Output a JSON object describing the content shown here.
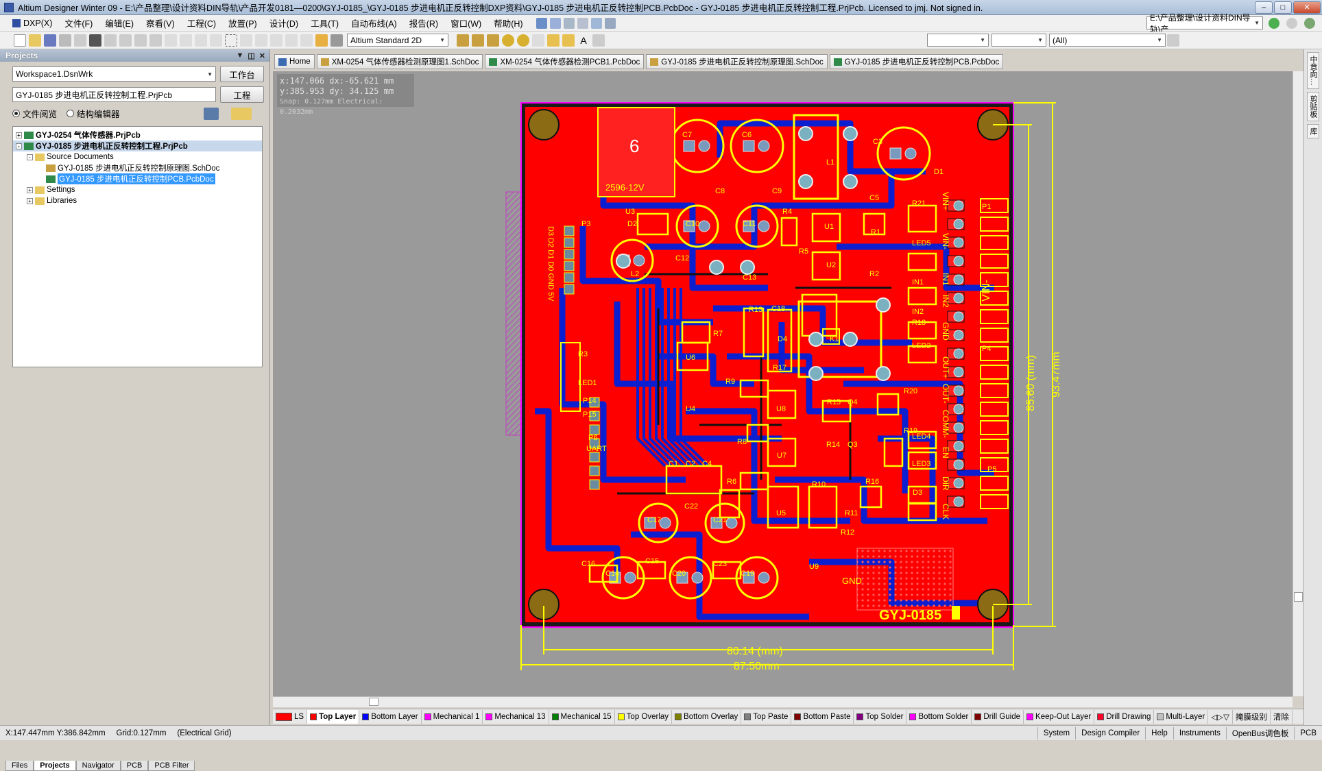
{
  "titlebar": {
    "title": "Altium Designer Winter 09 - E:\\产品整理\\设计资料DIN导轨\\产品开发0181—0200\\GYJ-0185_\\GYJ-0185 步进电机正反转控制DXP资料\\GYJ-0185 步进电机正反转控制PCB.PcbDoc - GYJ-0185 步进电机正反转控制工程.PrjPcb. Licensed to jmj. Not signed in."
  },
  "menu": {
    "dxp": "DXP(X)",
    "items": [
      "文件(F)",
      "编辑(E)",
      "察看(V)",
      "工程(C)",
      "放置(P)",
      "设计(D)",
      "工具(T)",
      "自动布线(A)",
      "报告(R)",
      "窗口(W)",
      "帮助(H)"
    ],
    "path_box": "E:\\产品整理\\设计资料DIN导轨\\产"
  },
  "toolbar": {
    "view_mode": "Altium Standard 2D",
    "filter_all": "(All)"
  },
  "projects_panel": {
    "title": "Projects",
    "workspace": "Workspace1.DsnWrk",
    "workspace_btn": "工作台",
    "project": "GYJ-0185 步进电机正反转控制工程.PrjPcb",
    "project_btn": "工程",
    "radio_files": "文件阅览",
    "radio_struct": "结构编辑器",
    "tree": [
      {
        "label": "GYJ-0254 气体传感器.PrjPcb",
        "indent": 0,
        "exp": "+",
        "bold": true
      },
      {
        "label": "GYJ-0185 步进电机正反转控制工程.PrjPcb",
        "indent": 0,
        "exp": "-",
        "bold": true,
        "hl": true
      },
      {
        "label": "Source Documents",
        "indent": 1,
        "exp": "-"
      },
      {
        "label": "GYJ-0185 步进电机正反转控制原理图.SchDoc",
        "indent": 2,
        "exp": ""
      },
      {
        "label": "GYJ-0185 步进电机正反转控制PCB.PcbDoc",
        "indent": 2,
        "exp": "",
        "sel": true
      },
      {
        "label": "Settings",
        "indent": 1,
        "exp": "+"
      },
      {
        "label": "Libraries",
        "indent": 1,
        "exp": "+"
      }
    ],
    "tabs": [
      "Files",
      "Projects",
      "Navigator",
      "PCB",
      "PCB Filter"
    ]
  },
  "doc_tabs": [
    {
      "label": "Home",
      "color": "#3a6ab0"
    },
    {
      "label": "XM-0254 气体传感器检测原理图1.SchDoc",
      "color": "#c8a040"
    },
    {
      "label": "XM-0254 气体传感器检测PCB1.PcbDoc",
      "color": "#2f8a4a"
    },
    {
      "label": "GYJ-0185 步进电机正反转控制原理图.SchDoc",
      "color": "#c8a040"
    },
    {
      "label": "GYJ-0185 步进电机正反转控制PCB.PcbDoc",
      "color": "#2f8a4a"
    }
  ],
  "hud": {
    "line1": "x:147.066   dx:-65.621 mm",
    "line2": "y:385.953   dy: 34.125  mm",
    "line3": "Snap: 0.127mm Electrical: 0.2032mm"
  },
  "pcb": {
    "board_label": "GYJ-0185",
    "relay_text": "2596-12V",
    "relay_num": "6",
    "dim_inner_w": "80.14 (mm)",
    "dim_outer_w": "87.50mm",
    "dim_inner_h": "85.60 (mm)",
    "dim_outer_h": "93.47mm",
    "gnd": "GND",
    "refs": [
      "C7",
      "C6",
      "C3",
      "L1",
      "D1",
      "C8",
      "C9",
      "C5",
      "R21",
      "P1",
      "U3",
      "D2",
      "C10",
      "C11",
      "R4",
      "U1",
      "R1",
      "LED5",
      "L2",
      "C12",
      "C13",
      "R5",
      "U2",
      "R2",
      "IN1",
      "IN2",
      "P3",
      "C18",
      "R18",
      "LED2",
      "R7",
      "R13",
      "D4",
      "K1",
      "P4",
      "U6",
      "R17",
      "R3",
      "R9",
      "R20",
      "LED1",
      "U4",
      "P14",
      "P15",
      "U8",
      "R15",
      "Q4",
      "P6",
      "UART",
      "R8",
      "R14",
      "Q3",
      "R19",
      "LED4",
      "LED3",
      "U7",
      "P5",
      "C1",
      "C2",
      "C4",
      "R6",
      "R10",
      "R16",
      "C22",
      "U5",
      "R11",
      "R12",
      "D3",
      "C17",
      "C21",
      "C16",
      "C15",
      "C23",
      "C14",
      "C20",
      "C19",
      "U9",
      "VIN+",
      "VIN-",
      "IN1",
      "IN2",
      "GND",
      "OUT+",
      "OUT-",
      "COM",
      "M-",
      "EN",
      "DIR",
      "CLK",
      "D3 D2 D1 D0 GND 5V",
      "P1.4",
      "P1.5",
      "GND",
      "VIN-",
      "VIN+"
    ]
  },
  "layers": [
    {
      "label": "LS",
      "color": "#ff0000"
    },
    {
      "label": "Top Layer",
      "color": "#ff0000",
      "on": true
    },
    {
      "label": "Bottom Layer",
      "color": "#0000ff"
    },
    {
      "label": "Mechanical 1",
      "color": "#ff00ff"
    },
    {
      "label": "Mechanical 13",
      "color": "#ff00ff"
    },
    {
      "label": "Mechanical 15",
      "color": "#008000"
    },
    {
      "label": "Top Overlay",
      "color": "#ffff00"
    },
    {
      "label": "Bottom Overlay",
      "color": "#808000"
    },
    {
      "label": "Top Paste",
      "color": "#808080"
    },
    {
      "label": "Bottom Paste",
      "color": "#800000"
    },
    {
      "label": "Top Solder",
      "color": "#800080"
    },
    {
      "label": "Bottom Solder",
      "color": "#ff00ff"
    },
    {
      "label": "Drill Guide",
      "color": "#800000"
    },
    {
      "label": "Keep-Out Layer",
      "color": "#ff00ff"
    },
    {
      "label": "Drill Drawing",
      "color": "#ff002a"
    },
    {
      "label": "Multi-Layer",
      "color": "#c0c0c0"
    }
  ],
  "layer_tail": [
    "掩膜级别",
    "清除"
  ],
  "status": {
    "coords": "X:147.447mm Y:386.842mm",
    "grid": "Grid:0.127mm",
    "elec": "(Electrical Grid)",
    "right": [
      "System",
      "Design Compiler",
      "Help",
      "Instruments",
      "OpenBus调色板",
      "PCB"
    ]
  },
  "rightstrip": [
    "中意向…",
    "剪贴板",
    "库"
  ]
}
